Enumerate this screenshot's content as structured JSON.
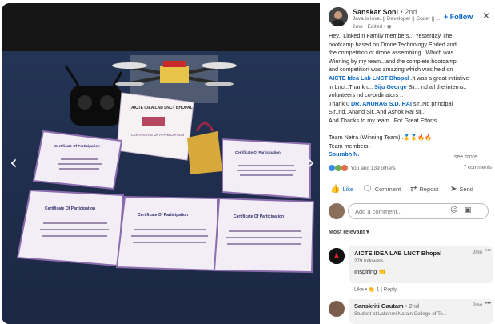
{
  "photo": {
    "prev_glyph": "‹",
    "next_glyph": "›",
    "banner": "AICTE IDEA LAB LNCT BHOPAL",
    "appreciation": "CERTIFICATE OF APPRECIATION",
    "cert_title": "Certificate Of Participation",
    "cert_body": "For Actively Participating in the Bootcamp on Drone Technology Organized by AICTE Idea Lab LNCT Bhopal",
    "colors": {
      "background": "#1a1a1a",
      "table": "#2c3e63",
      "cert_paper": "#f3eef6",
      "cert_border": "#8b6cae"
    }
  },
  "post": {
    "author": {
      "name": "Sanskar Soni",
      "degree": "• 2nd",
      "headline": "Java is love..|| Developer || Coder || ...",
      "meta": "2mo • Edited • ◉"
    },
    "follow_label": "+ Follow",
    "close_glyph": "✕",
    "lines": [
      [
        "Hey.. LinkedIn Family members... Yesterday The"
      ],
      [
        "bootcamp based on Drone Technology Ended and"
      ],
      [
        "the competition of drone assembling...Which was"
      ],
      [
        "Winning by my team...and the complete bootcamp"
      ],
      [
        "and competition was amazing which was held on"
      ],
      [
        {
          "text": "AICTE Idea Lab LNCT Bhopal",
          "link": true
        },
        " .It was a great initiative"
      ],
      [
        "in Lnct..Thank u.. ",
        {
          "text": "Siju George",
          "link": true
        },
        " Sir... nd all the interns.."
      ],
      [
        "volunteers nd co-ordinators .."
      ],
      [
        "Thank u ",
        {
          "text": "DR. ANURAG S.D. RAI",
          "link": true
        },
        " sir..Nd principal"
      ],
      [
        "Sir..nd..Anand Sir..And Ashok Rai sir.."
      ],
      [
        "And Thanks to my team...For Great Efforts.."
      ],
      [
        ""
      ],
      [
        "Team Netra (Winning Team)..🥇🥇🔥🔥"
      ],
      [
        "Team members:-"
      ],
      [
        {
          "text": "Sourabh N.",
          "link": true
        }
      ]
    ],
    "see_more": "...see more",
    "reactions": "You and 139 others",
    "comments_count": "7 comments",
    "actions": {
      "like": "Like",
      "comment": "Comment",
      "repost": "Repost",
      "send": "Send"
    },
    "comment_placeholder": "Add a comment...",
    "sort_label": "Most relevant ▾",
    "colors": {
      "accent": "#0a66c2",
      "like_icon": "#378fe9",
      "celebrate_icon": "#6dae4f",
      "heart_icon": "#df704d"
    }
  },
  "comments": [
    {
      "name": "AICTE IDEA LAB LNCT Bhopal",
      "degree": "",
      "sub": "279 followers",
      "time": "2mo",
      "more": "•••",
      "body": "Inspiring 👏",
      "actions": {
        "like": "Like",
        "reaction": "👏",
        "count": "1",
        "sep": "|",
        "reply": "Reply"
      }
    },
    {
      "name": "Sanskriti Gautam",
      "degree": "• 2nd",
      "sub": "Student at Lakshmi Narain College of Te...",
      "time": "2mo",
      "more": "•••"
    }
  ]
}
